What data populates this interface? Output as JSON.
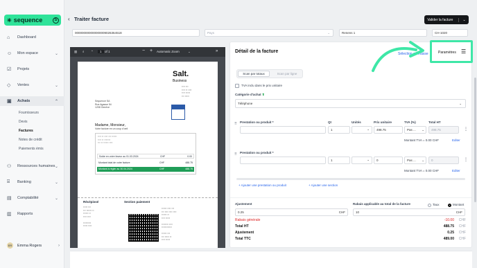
{
  "sidebar": {
    "brand": "sequence",
    "items": [
      {
        "label": "Dashboard",
        "icon": "home-icon"
      },
      {
        "label": "Mon espace",
        "icon": "user-icon"
      },
      {
        "label": "Projets",
        "icon": "check-square-icon"
      },
      {
        "label": "Ventes",
        "icon": "tag-icon"
      },
      {
        "label": "Achats",
        "icon": "bag-icon"
      },
      {
        "label": "Ressources humaines",
        "icon": "people-icon"
      },
      {
        "label": "Banking",
        "icon": "bank-icon"
      },
      {
        "label": "Comptabilité",
        "icon": "calculator-icon"
      },
      {
        "label": "Rapports",
        "icon": "chart-icon"
      }
    ],
    "sub_items": [
      "Fournisseurs",
      "Devis",
      "Factures",
      "Notes de crédit",
      "Paiements émis"
    ],
    "user": {
      "initials": "ER",
      "name": "Emma Rogers"
    }
  },
  "header": {
    "title": "Traiter facture",
    "validate_label": "Valider la facture"
  },
  "top_fields": {
    "reference": "000000000000000009026364518",
    "country_placeholder": "Pays",
    "city": "Renens 1",
    "postal": "CH-1020"
  },
  "pdf": {
    "page_current": "1",
    "page_total": "of 1",
    "zoom": "Automatic Zoom",
    "company": "Salt.",
    "company_sub": "Business",
    "addressee": [
      "Sequence SA",
      "Rue Agasse 54",
      "1208 Genève"
    ],
    "greeting": "Madame, Monsieur,",
    "sub_greeting": "Votre facture en un coup d'oeil",
    "summary": [
      {
        "label": "Solde en votre faveur au 01.03.2024",
        "cur": "CHF",
        "val": "0.00"
      },
      {
        "label": "Montant total de votre facture",
        "cur": "CHF",
        "val": "488.75"
      },
      {
        "label": "Montant à régler au 30.04.2024",
        "cur": "CHF",
        "val": "488.75"
      }
    ],
    "receipt_title": "Récépissé",
    "payment_section": "Section paiement"
  },
  "detail": {
    "title": "Détail de la facture",
    "select_mass": "Sélection en masse",
    "params": "Paramètres",
    "scan_total": "Scan par totaux",
    "scan_line": "Scan par ligne",
    "tva_included": "TVA inclu dans le prix unitaire",
    "category_label": "Catégorie d'achat",
    "category_value": "Téléphone",
    "col_prestation": "Prestation ou produit *",
    "col_qt": "Qt",
    "col_units": "Unités",
    "col_price": "Prix unitaire",
    "col_tva": "TVA (%)",
    "col_total": "Total HT",
    "lines": [
      {
        "qty": "1",
        "price": "498.75",
        "tva": "Pas ...",
        "total": "498.75",
        "montant_tva": "Montant TVA = 0.00 CHF"
      },
      {
        "qty": "1",
        "price": "0",
        "tva": "Pas ...",
        "total": "0",
        "montant_tva": "Montant TVA = 0.00 CHF"
      }
    ],
    "edit": "Editer",
    "add_line": "Ajouter une prestation ou produit",
    "add_section": "Ajouter une section",
    "adjust_label": "Ajustement",
    "adjust_value": "0.25",
    "discount_label": "Rabais applicable au total de la facture",
    "discount_value": "10",
    "taux": "Taux",
    "montant": "Montant",
    "cur": "CHF",
    "totals": [
      {
        "label": "Rabais générale",
        "value": "-10.00",
        "cur": "CHF",
        "red": true
      },
      {
        "label": "Total HT",
        "value": "488.75",
        "cur": "CHF"
      },
      {
        "label": "Ajustement",
        "value": "0.25",
        "cur": "CHF"
      },
      {
        "label": "Total TTC",
        "value": "489.00",
        "cur": "CHF"
      }
    ]
  },
  "colors": {
    "brand": "#2fe39a",
    "highlight": "#3ee7a7",
    "pdf_green": "#1f9d57"
  }
}
